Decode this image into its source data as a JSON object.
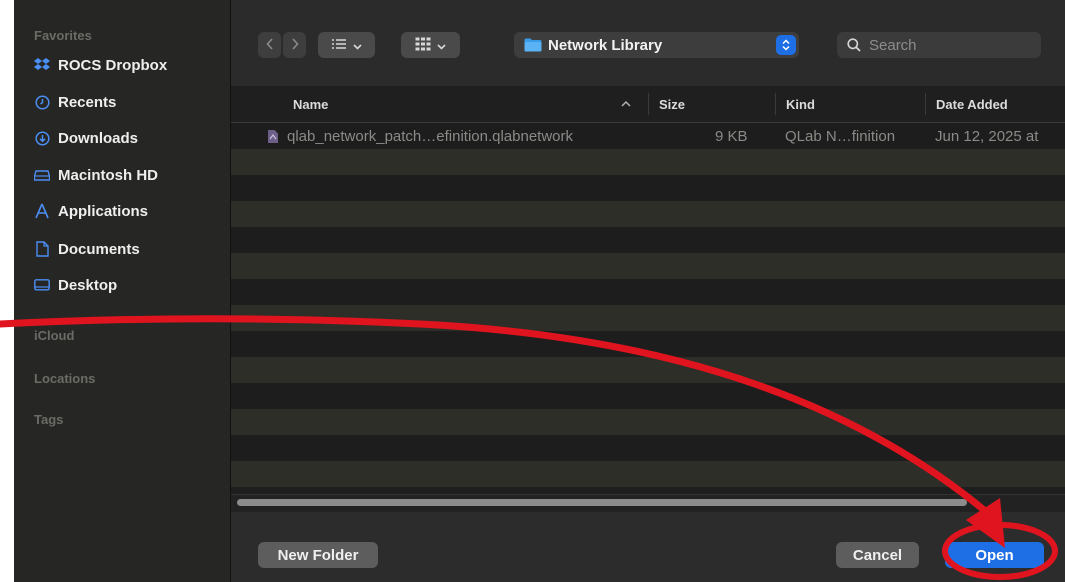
{
  "sidebar": {
    "favorites_heading": "Favorites",
    "items": [
      {
        "label": "ROCS Dropbox",
        "icon": "dropbox-icon"
      },
      {
        "label": "Recents",
        "icon": "clock-icon"
      },
      {
        "label": "Downloads",
        "icon": "download-icon"
      },
      {
        "label": "Macintosh HD",
        "icon": "disk-icon"
      },
      {
        "label": "Applications",
        "icon": "applications-icon"
      },
      {
        "label": "Documents",
        "icon": "document-icon"
      },
      {
        "label": "Desktop",
        "icon": "desktop-icon"
      }
    ],
    "icloud_heading": "iCloud",
    "locations_heading": "Locations",
    "tags_heading": "Tags"
  },
  "toolbar": {
    "location": "Network Library",
    "search_placeholder": "Search"
  },
  "columns": {
    "name": "Name",
    "size": "Size",
    "kind": "Kind",
    "date_added": "Date Added"
  },
  "files": [
    {
      "name": "qlab_network_patch…efinition.qlabnetwork",
      "size": "9 KB",
      "kind": "QLab N…finition",
      "date_added": "Jun 12, 2025 at"
    }
  ],
  "footer": {
    "new_folder": "New Folder",
    "cancel": "Cancel",
    "open": "Open"
  },
  "colors": {
    "accent": "#1e6fe6",
    "annotation": "#e0141e"
  }
}
